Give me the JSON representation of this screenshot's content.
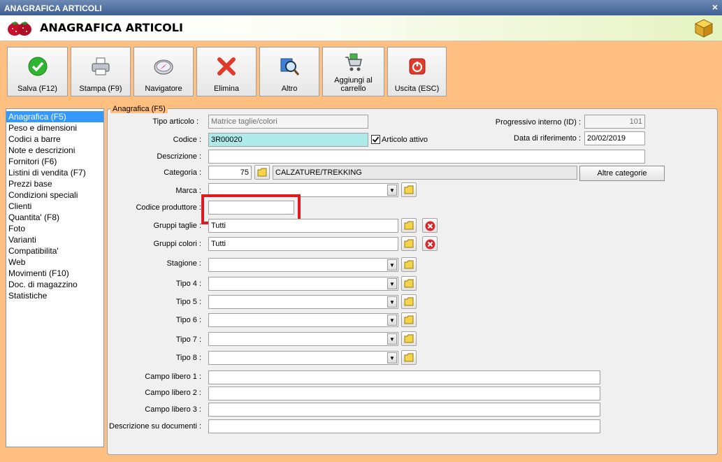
{
  "window": {
    "title": "ANAGRAFICA ARTICOLI",
    "close_glyph": "×"
  },
  "header": {
    "title": "ANAGRAFICA ARTICOLI",
    "logo_icon": "strawberries-icon",
    "right_icon": "boxes-icon"
  },
  "toolbar": {
    "buttons": [
      {
        "label": "Salva (F12)",
        "icon": "check-icon"
      },
      {
        "label": "Stampa (F9)",
        "icon": "printer-icon"
      },
      {
        "label": "Navigatore",
        "icon": "compass-icon"
      },
      {
        "label": "Elimina",
        "icon": "delete-x-icon"
      },
      {
        "label": "Altro",
        "icon": "magnifier-icon"
      },
      {
        "label": "Aggiungi al carrello",
        "icon": "cart-icon"
      },
      {
        "label": "Uscita (ESC)",
        "icon": "power-icon"
      }
    ]
  },
  "sidebar": {
    "items": [
      "Anagrafica (F5)",
      "Peso e dimensioni",
      "Codici a barre",
      "Note e descrizioni",
      "Fornitori (F6)",
      "Listini di vendita (F7)",
      "Prezzi base",
      "Condizioni speciali",
      "Clienti",
      "Quantita' (F8)",
      "Foto",
      "Varianti",
      "Compatibilita'",
      "Web",
      "Movimenti (F10)",
      "Doc. di magazzino",
      "Statistiche"
    ],
    "selected_index": 0
  },
  "form": {
    "group_title": "Anagrafica (F5)",
    "tipo_articolo": {
      "label": "Tipo articolo :",
      "value": "Matrice taglie/colori"
    },
    "codice": {
      "label": "Codice :",
      "value": "3R00020"
    },
    "articolo_attivo": {
      "label": "Articolo attivo",
      "checked": true
    },
    "progressivo": {
      "label": "Progressivo interno (ID) :",
      "value": "101"
    },
    "data_riferimento": {
      "label": "Data di riferimento :",
      "value": "20/02/2019"
    },
    "descrizione": {
      "label": "Descrizione :",
      "value": ""
    },
    "categoria": {
      "label": "Categoria :",
      "code": "75",
      "name": "CALZATURE/TREKKING",
      "altre_button": "Altre categorie"
    },
    "marca": {
      "label": "Marca :",
      "value": ""
    },
    "codice_produttore": {
      "label": "Codice produttore :",
      "value": ""
    },
    "gruppi_taglie": {
      "label": "Gruppi taglie :",
      "value": "Tutti"
    },
    "gruppi_colori": {
      "label": "Gruppi colori :",
      "value": "Tutti"
    },
    "stagione": {
      "label": "Stagione :",
      "value": ""
    },
    "tipo4": {
      "label": "Tipo 4 :",
      "value": ""
    },
    "tipo5": {
      "label": "Tipo 5 :",
      "value": ""
    },
    "tipo6": {
      "label": "Tipo 6 :",
      "value": ""
    },
    "tipo7": {
      "label": "Tipo 7 :",
      "value": ""
    },
    "tipo8": {
      "label": "Tipo 8 :",
      "value": ""
    },
    "campo1": {
      "label": "Campo libero 1 :",
      "value": ""
    },
    "campo2": {
      "label": "Campo libero 2 :",
      "value": ""
    },
    "campo3": {
      "label": "Campo libero 3 :",
      "value": ""
    },
    "desc_documenti": {
      "label": "Descrizione su documenti :",
      "value": ""
    }
  },
  "colors": {
    "background": "#ffbf80",
    "highlight": "#e0191f",
    "selection": "#3399ff",
    "code_field": "#aeeaea"
  }
}
